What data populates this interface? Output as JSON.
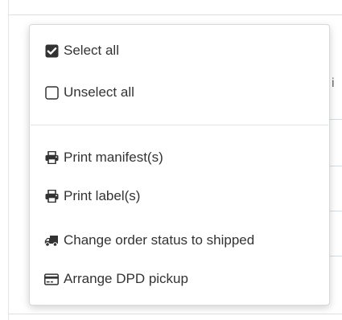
{
  "menu": {
    "items": [
      {
        "label": "Select all",
        "icon": "checked-checkbox-icon"
      },
      {
        "label": "Unselect all",
        "icon": "empty-checkbox-icon"
      },
      {
        "label": "Print manifest(s)",
        "icon": "printer-icon"
      },
      {
        "label": "Print label(s)",
        "icon": "printer-icon"
      },
      {
        "label": "Change order status to shipped",
        "icon": "truck-icon"
      },
      {
        "label": "Arrange DPD pickup",
        "icon": "credit-card-icon"
      }
    ]
  },
  "colors": {
    "text": "#333333",
    "icon": "#333333",
    "divider": "#e5e5e5",
    "menu_border": "#d9d9d9"
  }
}
